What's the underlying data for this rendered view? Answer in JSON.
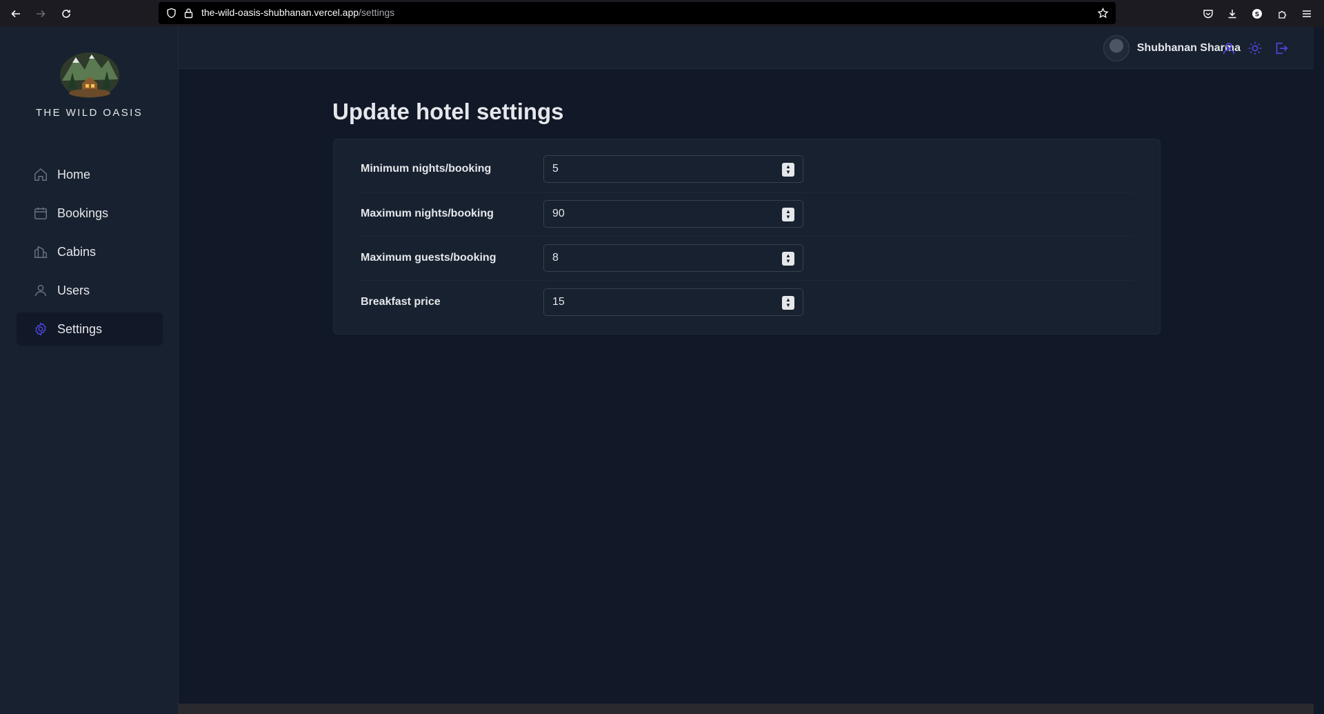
{
  "browser": {
    "url_host": "the-wild-oasis-shubhanan.vercel.app",
    "url_path": "/settings"
  },
  "sidebar": {
    "brand": "THE WILD OASIS",
    "items": [
      {
        "label": "Home",
        "icon": "home-icon"
      },
      {
        "label": "Bookings",
        "icon": "calendar-icon"
      },
      {
        "label": "Cabins",
        "icon": "building-icon"
      },
      {
        "label": "Users",
        "icon": "user-icon"
      },
      {
        "label": "Settings",
        "icon": "gear-icon",
        "active": true
      }
    ]
  },
  "header": {
    "user_name": "Shubhanan Sharma",
    "icons": [
      "user-icon",
      "sun-icon",
      "logout-icon"
    ]
  },
  "main": {
    "title": "Update hotel settings",
    "fields": [
      {
        "label": "Minimum nights/booking",
        "value": "5"
      },
      {
        "label": "Maximum nights/booking",
        "value": "90"
      },
      {
        "label": "Maximum guests/booking",
        "value": "8"
      },
      {
        "label": "Breakfast price",
        "value": "15"
      }
    ]
  },
  "colors": {
    "accent": "#4f46e5",
    "background": "#111827",
    "panel": "#18212f"
  }
}
